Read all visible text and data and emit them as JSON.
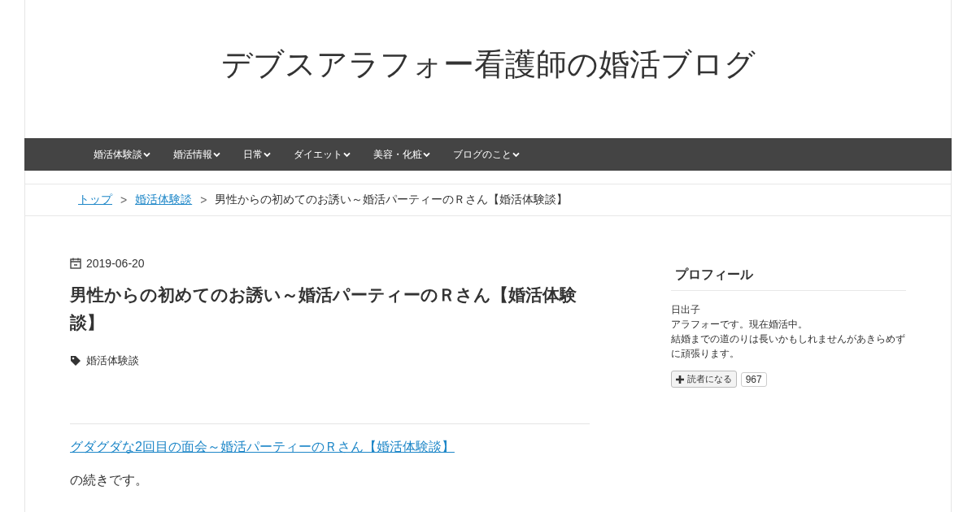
{
  "site_title": "デブスアラフォー看護師の婚活ブログ",
  "nav": [
    {
      "label": "婚活体験談"
    },
    {
      "label": "婚活情報"
    },
    {
      "label": "日常"
    },
    {
      "label": "ダイエット"
    },
    {
      "label": "美容・化粧"
    },
    {
      "label": "ブログのこと"
    }
  ],
  "breadcrumb": [
    {
      "label": "トップ",
      "kind": "link"
    },
    {
      "label": "婚活体験談",
      "kind": "link"
    },
    {
      "label": "男性からの初めてのお誘い～婚活パーティーのＲさん【婚活体験談】",
      "kind": "current"
    }
  ],
  "breadcrumb_separator": ">",
  "article": {
    "date": "2019-06-20",
    "title": "男性からの初めてのお誘い～婚活パーティーのＲさん【婚活体験談】",
    "category": "婚活体験談",
    "link": "グダグダな2回目の面会～婚活パーティーのＲさん【婚活体験談】",
    "text": "の続きです。"
  },
  "sidebar": {
    "heading": "プロフィール",
    "name": "日出子",
    "lines": [
      "アラフォーです。現在婚活中。",
      "結婚までの道のりは長いかもしれませんがあきらめずに頑張ります。"
    ],
    "subscribe_button": "読者になる",
    "subscriber_count": "967"
  }
}
